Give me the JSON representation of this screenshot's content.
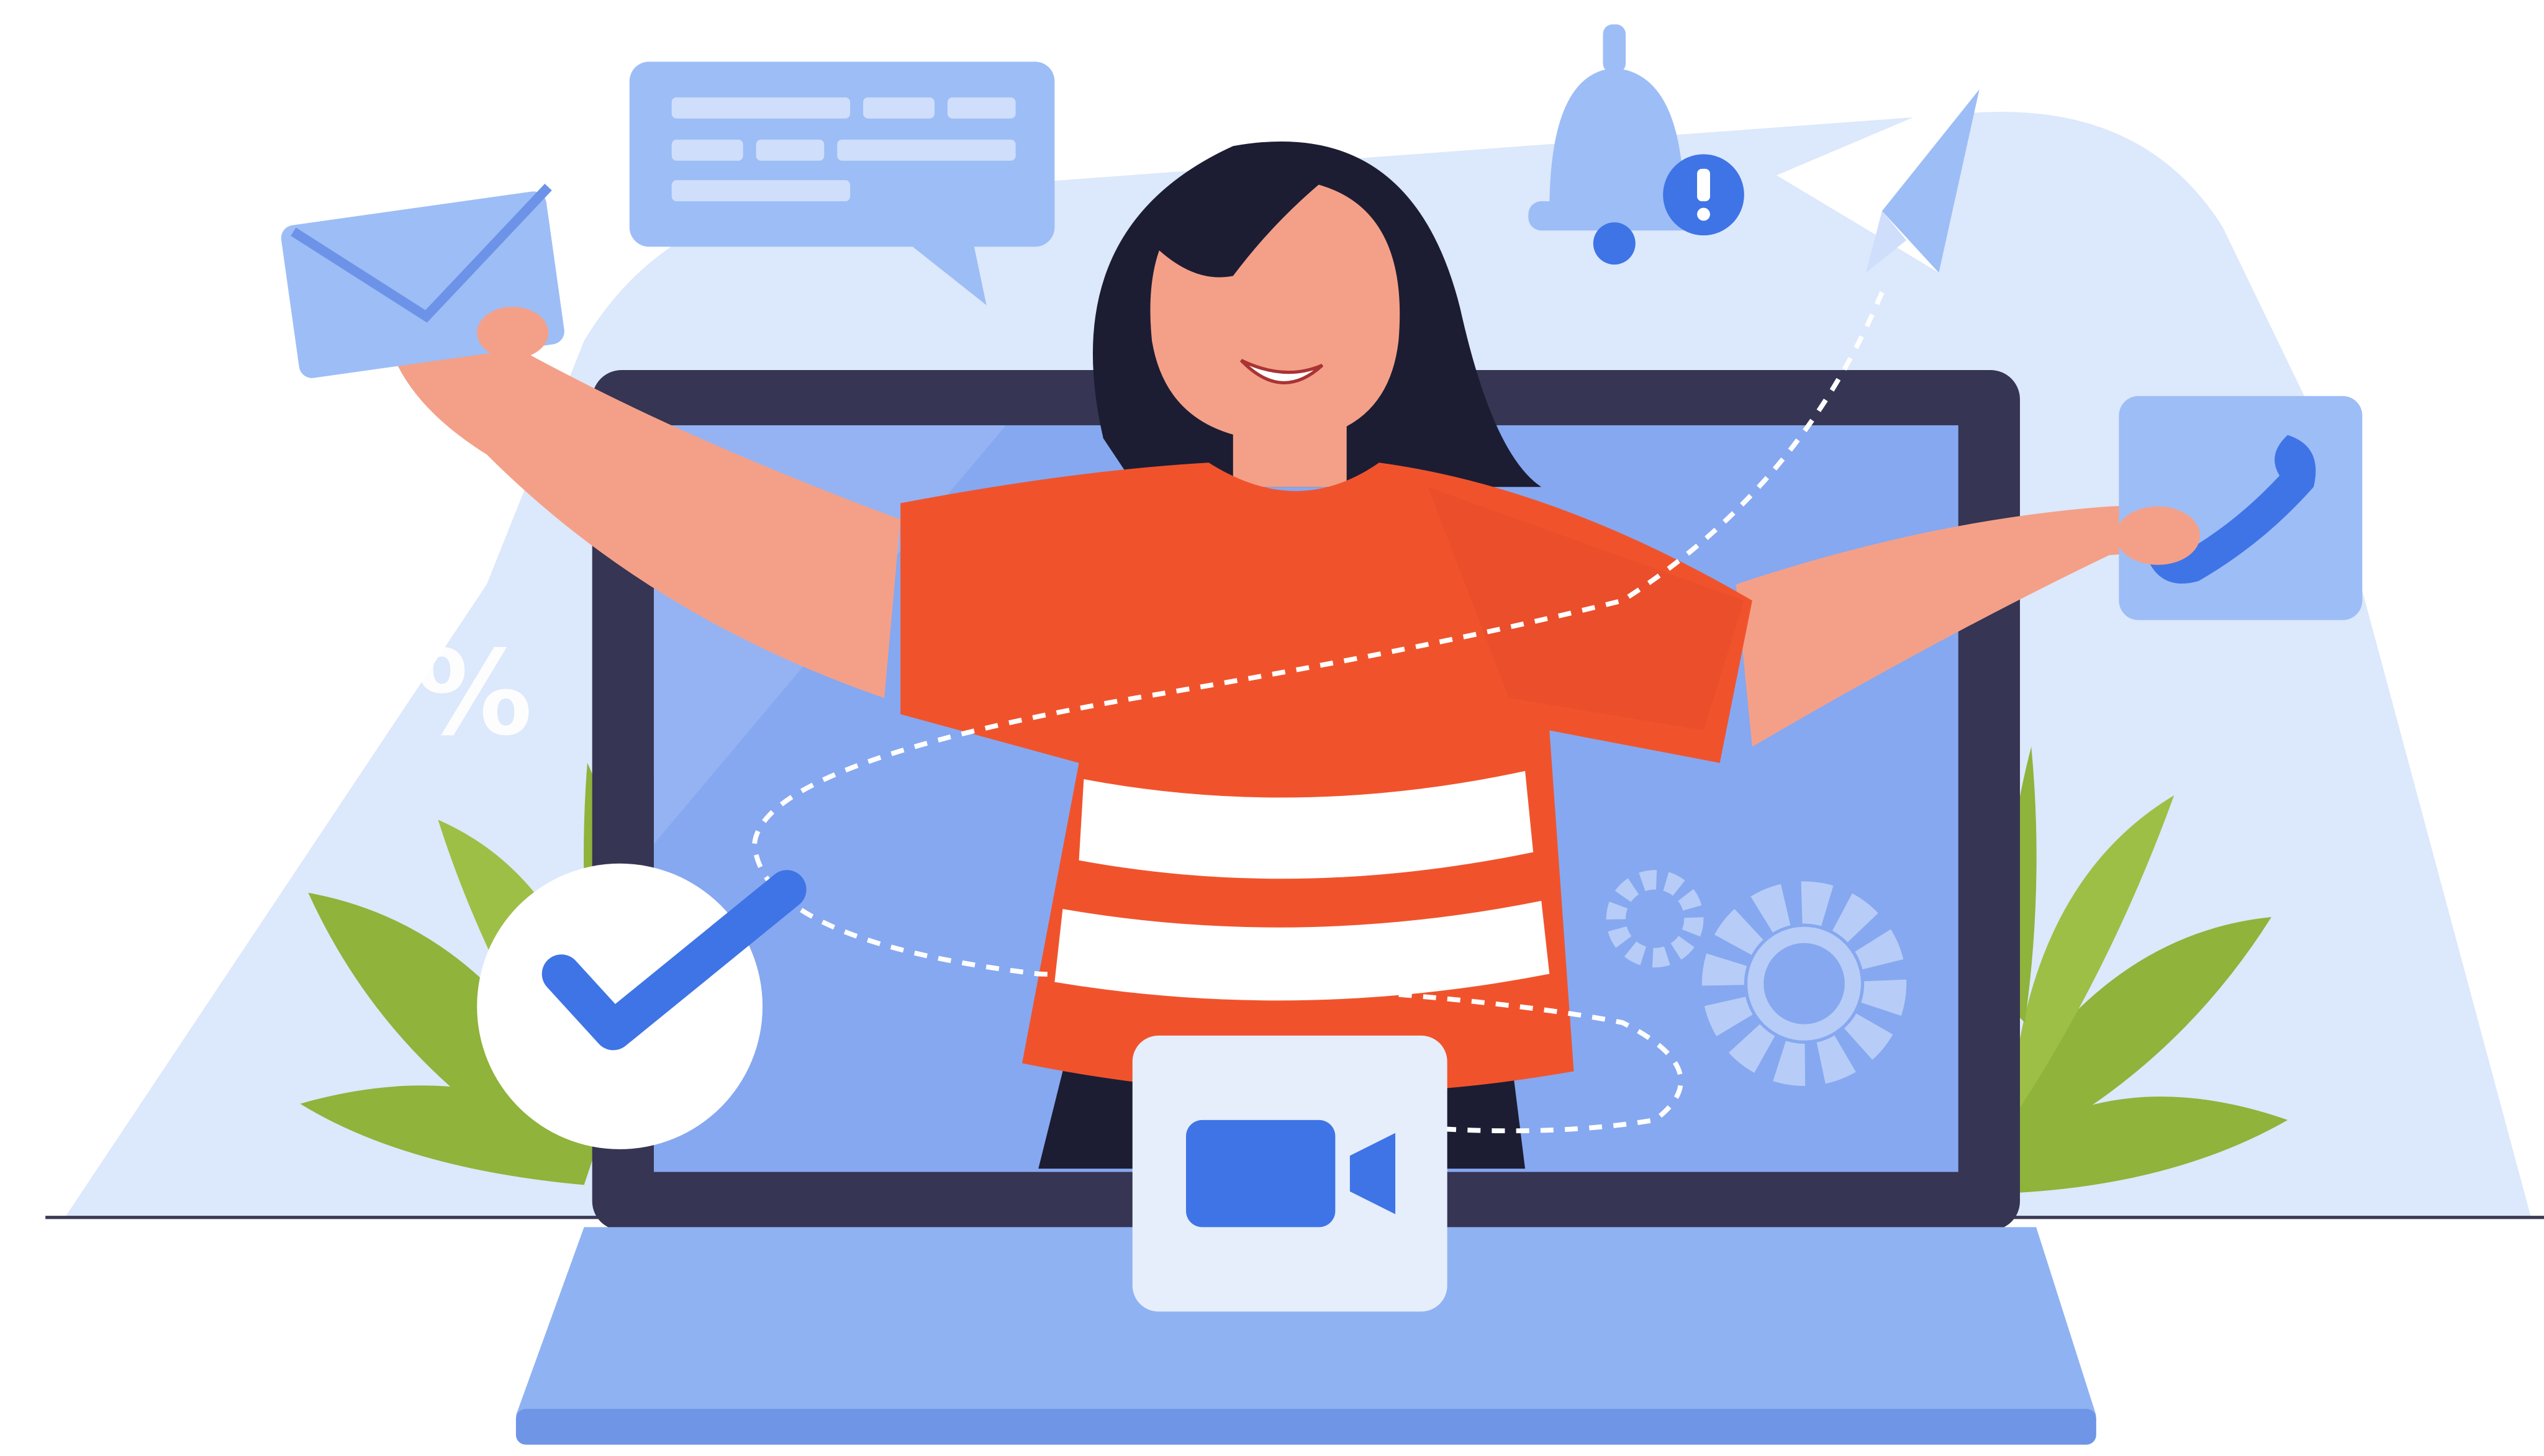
{
  "illustration": {
    "percent_symbol": "%",
    "icons": [
      "envelope-icon",
      "chat-bubble-icon",
      "bell-icon",
      "alert-icon",
      "paper-plane-icon",
      "phone-icon",
      "percent-icon",
      "checkmark-icon",
      "gear-icon",
      "video-camera-icon"
    ]
  },
  "colors": {
    "background": "#ffffff",
    "backdrop": "#dce8fb",
    "laptop_frame": "#363553",
    "screen": "#86a8f0",
    "laptop_base": "#8fb2f2",
    "accent_blue": "#3f74e6",
    "tile_blue": "#9dbdf6",
    "shirt": "#f0532c",
    "skin": "#f4a088",
    "hair": "#1c1d33",
    "leaf_green": "#8fb33b",
    "white": "#ffffff"
  }
}
